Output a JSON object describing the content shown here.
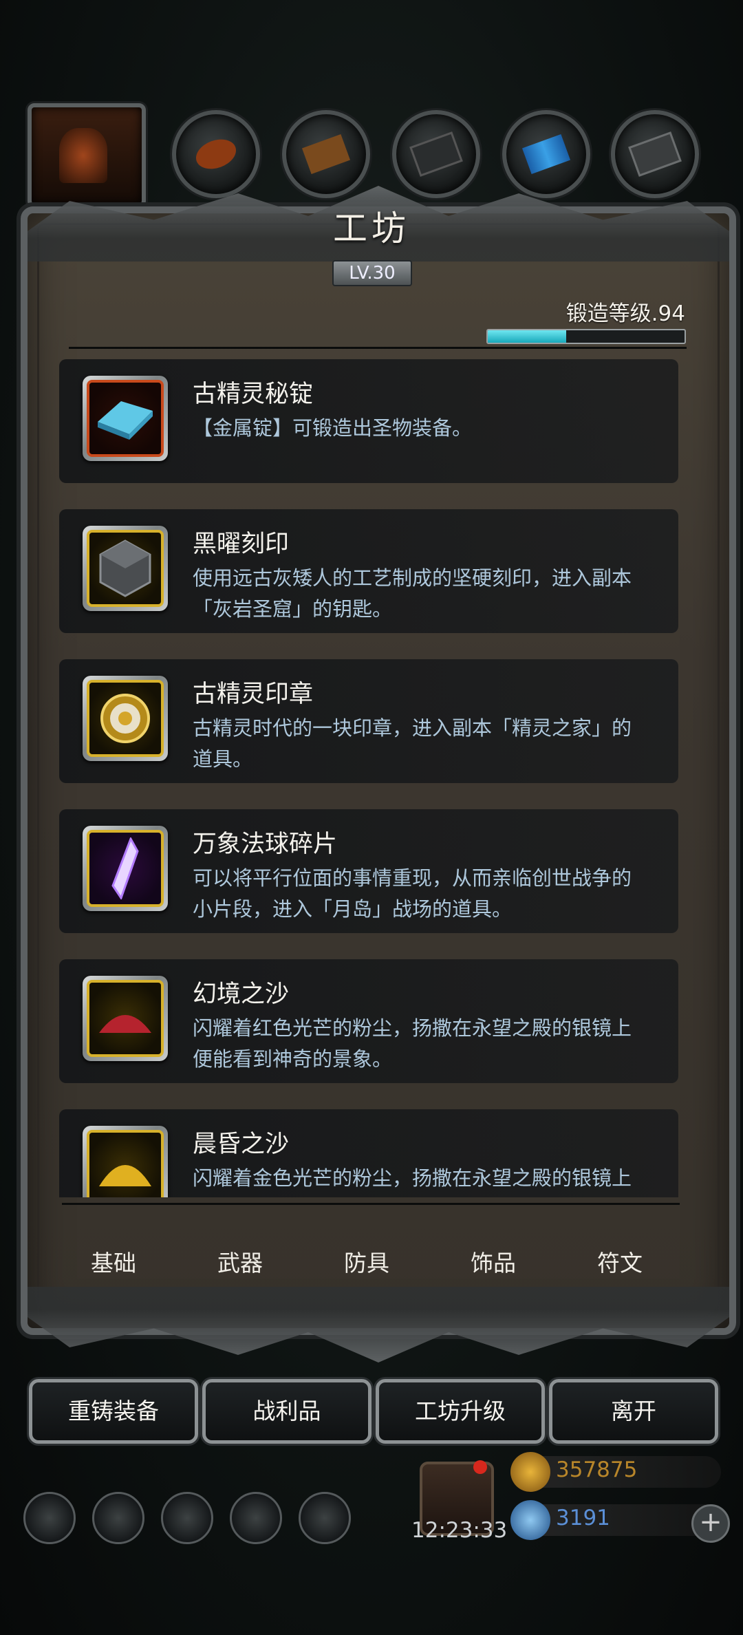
{
  "header": {
    "title": "工坊",
    "level_badge": "LV.30",
    "forge_level_label": "锻造等级.94",
    "forge_progress": 0.4
  },
  "items": [
    {
      "name": "古精灵秘锭",
      "desc": "【金属锭】可锻造出圣物装备。",
      "icon": "blue-ingot-icon",
      "frame": "red"
    },
    {
      "name": "黑曜刻印",
      "desc": "使用远古灰矮人的工艺制成的坚硬刻印，进入副本「灰岩圣窟」的钥匙。",
      "icon": "obsidian-seal-icon",
      "frame": "gold"
    },
    {
      "name": "古精灵印章",
      "desc": "古精灵时代的一块印章，进入副本「精灵之家」的道具。",
      "icon": "elf-seal-icon",
      "frame": "gold"
    },
    {
      "name": "万象法球碎片",
      "desc": "可以将平行位面的事情重现，从而亲临创世战争的小片段，进入「月岛」战场的道具。",
      "icon": "crystal-shard-icon",
      "frame": "gold"
    },
    {
      "name": "幻境之沙",
      "desc": "闪耀着红色光芒的粉尘，扬撒在永望之殿的银镜上便能看到神奇的景象。",
      "icon": "red-sand-icon",
      "frame": "gold"
    },
    {
      "name": "晨昏之沙",
      "desc": "闪耀着金色光芒的粉尘，扬撒在永望之殿的银镜上便能看到神奇的景象。",
      "icon": "gold-sand-icon",
      "frame": "gold"
    }
  ],
  "tabs": [
    "基础",
    "武器",
    "防具",
    "饰品",
    "符文"
  ],
  "actions": [
    "重铸装备",
    "战利品",
    "工坊升级",
    "离开"
  ],
  "footer": {
    "clock": "12:23:33",
    "gold": "357875",
    "diamond": "3191"
  },
  "colors": {
    "accent": "#6fe6f0",
    "desc": "#aec8dc",
    "gold_text": "#b8862a",
    "diamond_text": "#5b8fd6"
  }
}
